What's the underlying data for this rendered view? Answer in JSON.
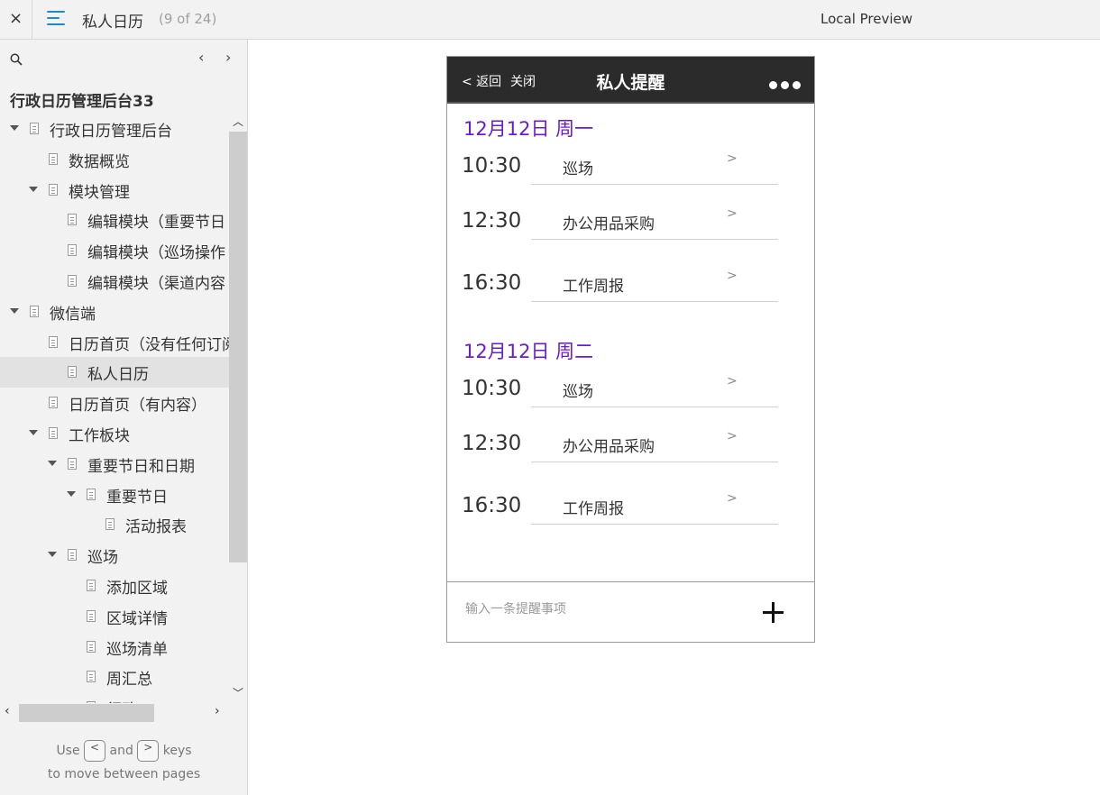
{
  "topbar": {
    "close_label": "×",
    "title": "私人日历",
    "page_count": "(9 of 24)",
    "local_preview": "Local Preview"
  },
  "sidebar": {
    "nav_prev": "‹",
    "nav_next": "›",
    "project_title": "行政日历管理后台33",
    "tree": [
      {
        "label": "行政日历管理后台",
        "expanded": true
      },
      {
        "label": "数据概览"
      },
      {
        "label": "模块管理",
        "expanded": true
      },
      {
        "label": "编辑模块（重要节日"
      },
      {
        "label": "编辑模块（巡场操作"
      },
      {
        "label": "编辑模块（渠道内容"
      },
      {
        "label": "微信端",
        "expanded": true
      },
      {
        "label": "日历首页（没有任何订阅"
      },
      {
        "label": "私人日历",
        "selected": true
      },
      {
        "label": "日历首页（有内容）"
      },
      {
        "label": "工作板块",
        "expanded": true
      },
      {
        "label": "重要节日和日期",
        "expanded": true
      },
      {
        "label": "重要节日",
        "expanded": true
      },
      {
        "label": "活动报表"
      },
      {
        "label": "巡场",
        "expanded": true
      },
      {
        "label": "添加区域"
      },
      {
        "label": "区域详情"
      },
      {
        "label": "巡场清单"
      },
      {
        "label": "周汇总"
      },
      {
        "label": "行政"
      }
    ],
    "hint_use": "Use",
    "hint_key_prev": "<",
    "hint_and": "and",
    "hint_key_next": ">",
    "hint_keys": "keys",
    "hint_line2": "to move between pages"
  },
  "phone": {
    "back_label": "< 返回",
    "close_label": "关闭",
    "title": "私人提醒",
    "days": [
      {
        "heading": "12月12日 周一",
        "events": [
          {
            "time": "10:30",
            "title": "巡场",
            "chevron": ">"
          },
          {
            "time": "12:30",
            "title": "办公用品采购",
            "chevron": ">"
          },
          {
            "time": "16:30",
            "title": "工作周报",
            "chevron": ">"
          }
        ]
      },
      {
        "heading": "12月12日 周二",
        "events": [
          {
            "time": "10:30",
            "title": "巡场",
            "chevron": ">"
          },
          {
            "time": "12:30",
            "title": "办公用品采购",
            "chevron": ">"
          },
          {
            "time": "16:30",
            "title": "工作周报",
            "chevron": ">"
          }
        ]
      }
    ],
    "input_placeholder": "输入一条提醒事项",
    "input_value": ""
  },
  "colors": {
    "accent_blue": "#1b8ad6",
    "day_heading_purple": "#6a1bd1",
    "header_dark": "#2b2b2b"
  }
}
